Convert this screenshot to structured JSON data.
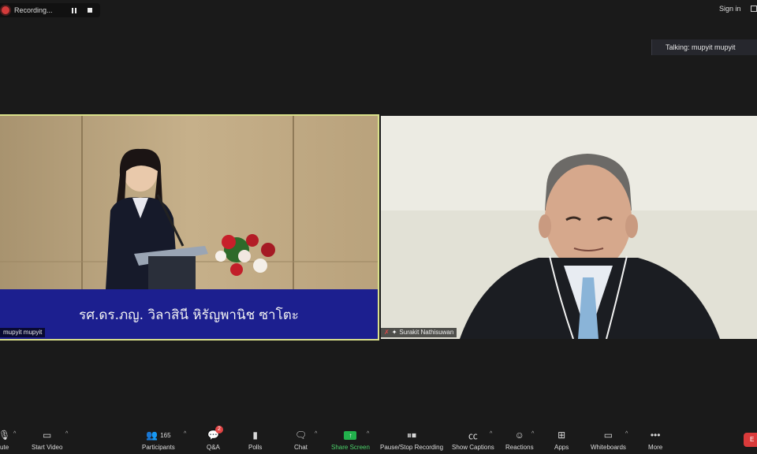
{
  "recording": {
    "label": "Recording..."
  },
  "header": {
    "signin_label": "Sign in"
  },
  "talking_indicator": "Talking: mupyit mupyit",
  "video_tiles": [
    {
      "name": "mupyit mupyit",
      "caption": "รศ.ดร.ภญ. วิลาสินี หิรัญพานิช ซาโตะ"
    },
    {
      "name": "Surakit Nathisuwan"
    }
  ],
  "toolbar": {
    "mute_label": "ute",
    "start_video_label": "Start Video",
    "participants_label": "Participants",
    "participants_count": "165",
    "qa_label": "Q&A",
    "qa_badge": "2",
    "polls_label": "Polls",
    "chat_label": "Chat",
    "share_screen_label": "Share Screen",
    "recording_label": "Pause/Stop Recording",
    "captions_label": "Show Captions",
    "reactions_label": "Reactions",
    "apps_label": "Apps",
    "whiteboards_label": "Whiteboards",
    "more_label": "More",
    "end_label": "E"
  },
  "colors": {
    "background": "#1a1a1a",
    "active_speaker_border": "#d9e08a",
    "share_screen_green": "#22b14c",
    "end_red": "#d93a3a",
    "caption_bar": "#1c1f8f"
  }
}
